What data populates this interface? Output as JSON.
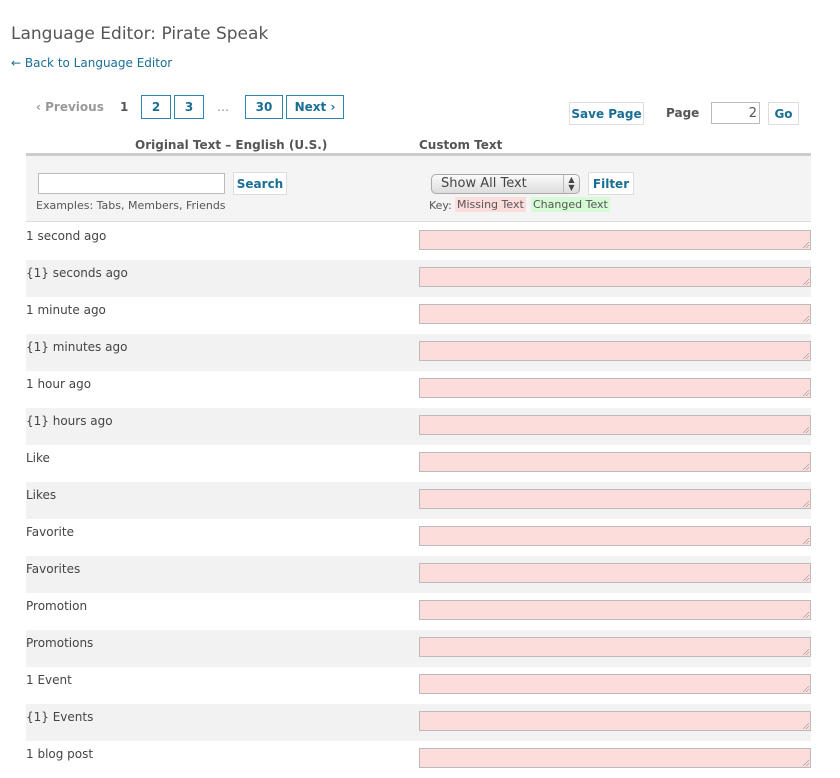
{
  "title": "Language Editor: Pirate Speak",
  "back_link": "← Back to Language Editor",
  "pagination": {
    "previous": "‹ Previous",
    "current": "1",
    "pages": [
      "2",
      "3"
    ],
    "ellipsis": "…",
    "last": "30",
    "next": "Next ›"
  },
  "save_page": "Save Page",
  "page_label": "Page",
  "page_value": "2",
  "go": "Go",
  "columns": {
    "original": "Original Text – English (U.S.)",
    "custom": "Custom Text"
  },
  "search": {
    "value": "",
    "button": "Search",
    "examples": "Examples: Tabs, Members, Friends"
  },
  "filter": {
    "selected": "Show All Text",
    "button": "Filter",
    "key_label": "Key:",
    "missing": "Missing Text",
    "changed": "Changed Text"
  },
  "colors": {
    "missing": "#fddcdc",
    "changed": "#d6fad6",
    "link": "#1a6e96"
  },
  "rows": [
    "1 second ago",
    "{1} seconds ago",
    "1 minute ago",
    "{1} minutes ago",
    "1 hour ago",
    "{1} hours ago",
    "Like",
    "Likes",
    "Favorite",
    "Favorites",
    "Promotion",
    "Promotions",
    "1 Event",
    "{1} Events",
    "1 blog post"
  ]
}
